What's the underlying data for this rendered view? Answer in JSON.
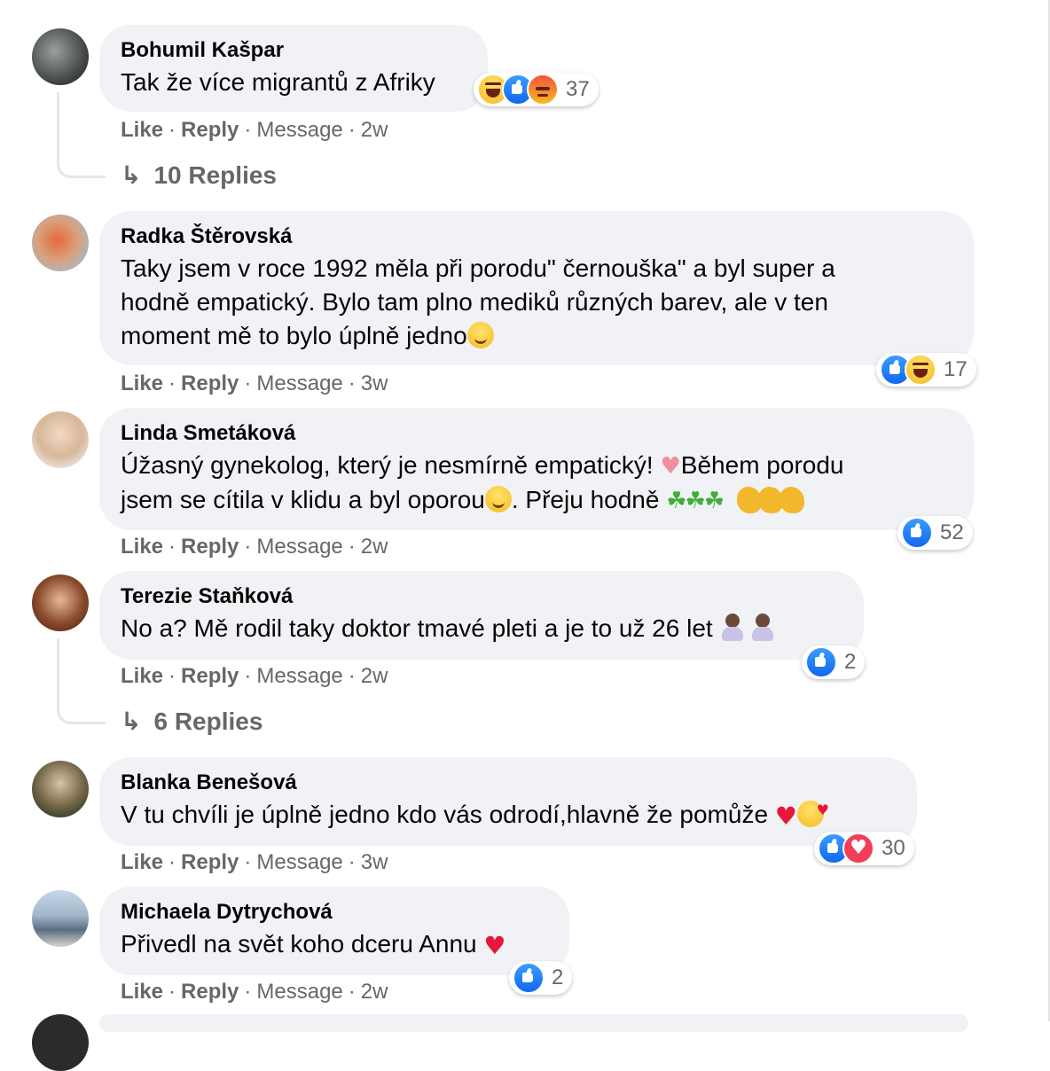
{
  "comments": [
    {
      "author": "Bohumil Kašpar",
      "text": "Tak že více migrantů z Afriky",
      "reactions_count": "37",
      "reaction_types": [
        "haha",
        "like",
        "angry"
      ],
      "actions": {
        "like": "Like",
        "reply": "Reply",
        "message": "Message",
        "time": "2w"
      },
      "replies_label": "10 Replies"
    },
    {
      "author": "Radka Štěrovská",
      "text_line1": "Taky jsem v roce 1992 měla při porodu\" černouška\" a byl super a",
      "text_line2": "hodně empatický. Bylo tam plno mediků různých barev, ale v ten",
      "text_line3": "moment mě to bylo úplně jedno",
      "reactions_count": "17",
      "reaction_types": [
        "like",
        "haha"
      ],
      "actions": {
        "like": "Like",
        "reply": "Reply",
        "message": "Message",
        "time": "3w"
      }
    },
    {
      "author": "Linda Smetáková",
      "text_line1a": "Úžasný gynekolog, který je nesmírně empatický! ",
      "text_line1b": "Během porodu",
      "text_line2a": "jsem se cítila v klidu a byl oporou",
      "text_line2b": ". Přeju hodně ",
      "reactions_count": "52",
      "reaction_types": [
        "like"
      ],
      "actions": {
        "like": "Like",
        "reply": "Reply",
        "message": "Message",
        "time": "2w"
      }
    },
    {
      "author": "Terezie Staňková",
      "text": "No a? Mě rodil taky doktor tmavé pleti a je to už 26 let",
      "reactions_count": "2",
      "reaction_types": [
        "like"
      ],
      "actions": {
        "like": "Like",
        "reply": "Reply",
        "message": "Message",
        "time": "2w"
      },
      "replies_label": "6 Replies"
    },
    {
      "author": "Blanka Benešová",
      "text": "V tu chvíli je úplně jedno kdo vás odrodí,hlavně že pomůže",
      "reactions_count": "30",
      "reaction_types": [
        "like",
        "love"
      ],
      "actions": {
        "like": "Like",
        "reply": "Reply",
        "message": "Message",
        "time": "3w"
      }
    },
    {
      "author": "Michaela Dytrychová",
      "text": "Přivedl na svět koho dceru Annu",
      "reactions_count": "2",
      "reaction_types": [
        "like"
      ],
      "actions": {
        "like": "Like",
        "reply": "Reply",
        "message": "Message",
        "time": "2w"
      }
    }
  ],
  "colors": {
    "bubble_bg": "#f0f2f5",
    "secondary_text": "#65676b",
    "like_blue": "#1877f2",
    "love_red": "#f33e58"
  }
}
